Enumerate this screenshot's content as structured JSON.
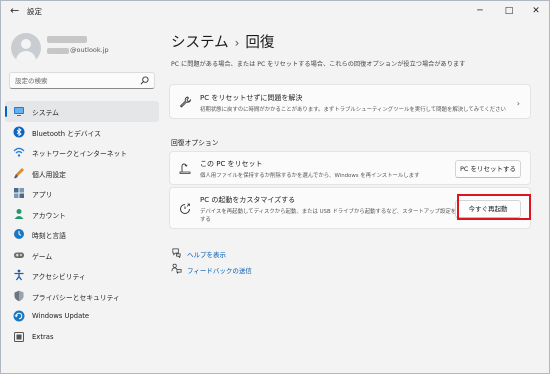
{
  "window": {
    "title": "設定",
    "controls": [
      "─",
      "□",
      "✕"
    ]
  },
  "user": {
    "email_suffix": "@outlook.jp"
  },
  "search": {
    "placeholder": "設定の検索"
  },
  "nav": {
    "items": [
      {
        "label": "システム",
        "icon": "system-icon",
        "color": "#0a64c2",
        "active": true
      },
      {
        "label": "Bluetooth とデバイス",
        "icon": "bluetooth-icon",
        "color": "#0a64c2"
      },
      {
        "label": "ネットワークとインターネット",
        "icon": "network-icon",
        "color": "#2a7fd4"
      },
      {
        "label": "個人用設定",
        "icon": "brush-icon",
        "color": "#e08a2a"
      },
      {
        "label": "アプリ",
        "icon": "apps-icon",
        "color": "#4a6b8a"
      },
      {
        "label": "アカウント",
        "icon": "account-icon",
        "color": "#1f9a6b"
      },
      {
        "label": "時刻と言語",
        "icon": "time-language-icon",
        "color": "#1a78c2"
      },
      {
        "label": "ゲーム",
        "icon": "game-icon",
        "color": "#6b6b6b"
      },
      {
        "label": "アクセシビリティ",
        "icon": "accessibility-icon",
        "color": "#1a5fb4"
      },
      {
        "label": "プライバシーとセキュリティ",
        "icon": "shield-icon",
        "color": "#6b7480"
      },
      {
        "label": "Windows Update",
        "icon": "windows-update-icon",
        "color": "#1a78c2"
      },
      {
        "label": "Extras",
        "icon": "extras-icon",
        "color": "#555555"
      }
    ]
  },
  "main": {
    "breadcrumb_parent": "システム",
    "breadcrumb_sep": "›",
    "title": "回復",
    "description": "PC に問題がある場合、または PC をリセットする場合、これらの回復オプションが役立つ場合があります",
    "troubleshoot": {
      "title": "PC をリセットせずに問題を解決",
      "desc": "初期状態に戻すのに時間がかかることがあります。まずトラブルシューティングツールを実行して問題を解決してみてください",
      "chevron": "›"
    },
    "section_header": "回復オプション",
    "reset": {
      "title": "この PC をリセット",
      "desc": "個人用ファイルを保持するか削除するかを選んでから、Windows を再インストールします",
      "button": "PC をリセットする"
    },
    "advanced": {
      "title": "PC の起動をカスタマイズする",
      "desc_line1": "デバイスを再起動してディスクから起動、または USB ドライブから起動するなど、スタートアップ設定を変更",
      "desc_line2": "する",
      "button": "今すぐ再起動"
    },
    "links": [
      {
        "label": "ヘルプを表示",
        "icon": "help-icon"
      },
      {
        "label": "フィードバックの送信",
        "icon": "feedback-icon"
      }
    ]
  },
  "colors": {
    "accent": "#0067c0",
    "highlight": "#e0141e",
    "link": "#0059b5"
  }
}
